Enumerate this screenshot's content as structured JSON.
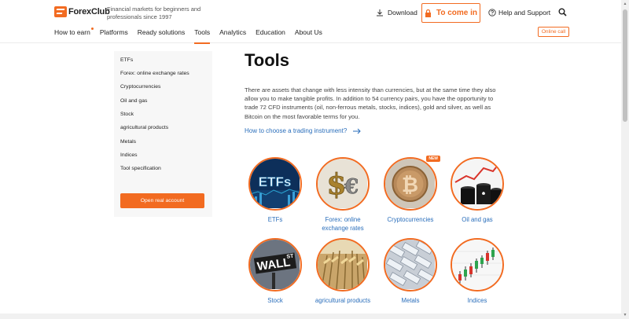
{
  "header": {
    "logo_text": "ForexClub",
    "tagline": "Financial markets for beginners and professionals since 1997",
    "download_label": "Download",
    "come_in_label": "To come in",
    "help_label": "Help and Support",
    "accent_color": "#f26b21"
  },
  "nav": {
    "items": [
      "How to earn",
      "Platforms",
      "Ready solutions",
      "Tools",
      "Analytics",
      "Education",
      "About Us"
    ],
    "active": "Tools",
    "online_call": "Online call"
  },
  "sidebar": {
    "items": [
      "ETFs",
      "Forex: online exchange rates",
      "Cryptocurrencies",
      "Oil and gas",
      "Stock",
      "agricultural products",
      "Metals",
      "Indices",
      "Tool specification"
    ],
    "open_account": "Open real account"
  },
  "main": {
    "title": "Tools",
    "intro": "There are assets that change with less intensity than currencies, but at the same time they also allow you to make tangible profits. In addition to 54 currency pairs, you have the opportunity to trade 72 CFD instruments (oil, non-ferrous metals, stocks, indices), gold and silver, as well as Bitcoin on the most favorable terms for you.",
    "choose_link": "How to choose a trading instrument?",
    "tools": [
      {
        "label": "ETFs",
        "icon": "etfs-icon"
      },
      {
        "label": "Forex: online exchange rates",
        "icon": "currency-icon"
      },
      {
        "label": "Cryptocurrencies",
        "icon": "bitcoin-icon",
        "badge": "NEW"
      },
      {
        "label": "Oil and gas",
        "icon": "oil-barrels-icon"
      },
      {
        "label": "Stock",
        "icon": "wall-street-sign-icon"
      },
      {
        "label": "agricultural products",
        "icon": "wheat-icon"
      },
      {
        "label": "Metals",
        "icon": "metal-bars-icon"
      },
      {
        "label": "Indices",
        "icon": "candlestick-chart-icon"
      }
    ]
  }
}
